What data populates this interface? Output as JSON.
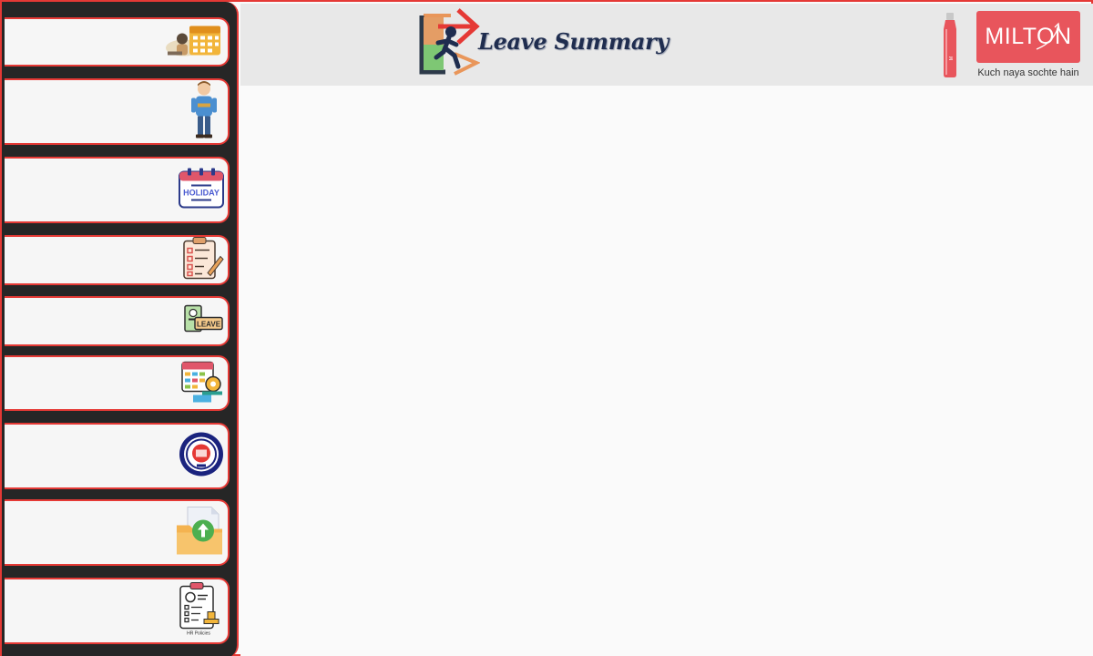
{
  "header": {
    "title": "Leave Summary",
    "title_icon": "exit-run-icon"
  },
  "brand": {
    "name": "MILTON",
    "tagline": "Kuch naya sochte hain",
    "accent": "#e8555c",
    "product_icon": "water-bottle-icon"
  },
  "sidebar": {
    "items": [
      {
        "icon": "calendar-planner-icon"
      },
      {
        "icon": "employee-profile-icon"
      },
      {
        "icon": "holiday-calendar-icon",
        "icon_text": "HOLIDAY"
      },
      {
        "icon": "checklist-clipboard-icon"
      },
      {
        "icon": "leave-id-card-icon",
        "icon_text": "LEAVE"
      },
      {
        "icon": "attendance-schedule-icon"
      },
      {
        "icon": "epfo-seal-icon"
      },
      {
        "icon": "upload-folder-icon"
      },
      {
        "icon": "hr-policies-icon",
        "icon_text": "HR Policies"
      }
    ]
  },
  "colors": {
    "frame_border": "#e53935",
    "sidebar_bg": "#262626",
    "header_bg": "#e8e8e8",
    "title_color": "#1f2d4f"
  }
}
